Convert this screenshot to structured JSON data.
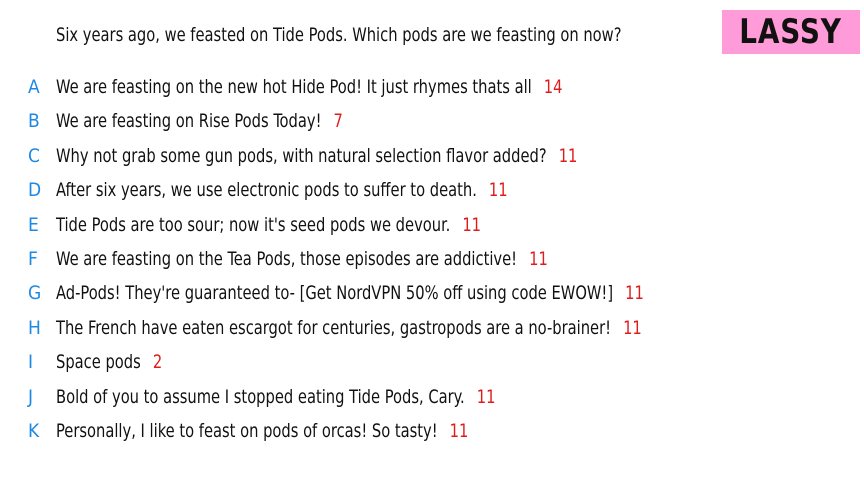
{
  "question": "Six years ago, we feasted on Tide Pods. Which pods are we feasting on now?",
  "badge": {
    "label": "LASSY",
    "color": "#ff9bd8"
  },
  "colors": {
    "letter": "#1e88e5",
    "score": "#e01b1b",
    "text": "#111111"
  },
  "answers": [
    {
      "letter": "A",
      "text": "We are feasting on the new hot Hide Pod! It just rhymes thats all",
      "score": "14"
    },
    {
      "letter": "B",
      "text": "We are feasting on Rise Pods Today!",
      "score": "7"
    },
    {
      "letter": "C",
      "text": "Why not grab some gun pods, with natural selection flavor added?",
      "score": "11"
    },
    {
      "letter": "D",
      "text": "After six years, we use electronic pods to suffer to death.",
      "score": "11"
    },
    {
      "letter": "E",
      "text": "Tide Pods are too sour; now it's seed pods we devour.",
      "score": "11"
    },
    {
      "letter": "F",
      "text": "We are feasting on the Tea Pods, those episodes are addictive!",
      "score": "11"
    },
    {
      "letter": "G",
      "text": "Ad-Pods! They're guaranteed to- [Get NordVPN 50% off using code EWOW!]",
      "score": "11"
    },
    {
      "letter": "H",
      "text": "The French have eaten escargot for centuries, gastropods are a no-brainer!",
      "score": "11"
    },
    {
      "letter": "I",
      "text": "Space pods",
      "score": "2"
    },
    {
      "letter": "J",
      "text": "Bold of you to assume I stopped eating Tide Pods, Cary.",
      "score": "11"
    },
    {
      "letter": "K",
      "text": "Personally, I like to feast on pods of orcas! So tasty!",
      "score": "11"
    }
  ]
}
